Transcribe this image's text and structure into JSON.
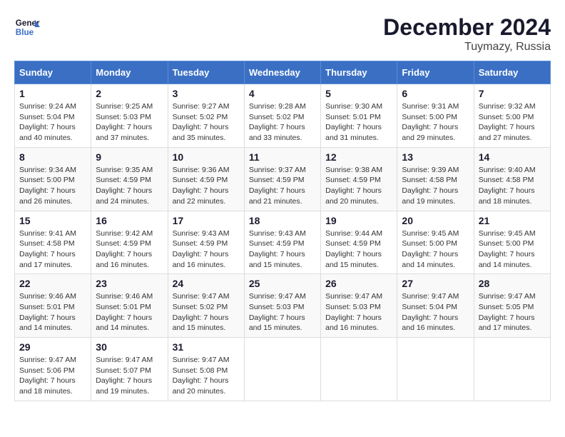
{
  "logo": {
    "line1": "General",
    "line2": "Blue"
  },
  "header": {
    "month": "December 2024",
    "location": "Tuymazy, Russia"
  },
  "weekdays": [
    "Sunday",
    "Monday",
    "Tuesday",
    "Wednesday",
    "Thursday",
    "Friday",
    "Saturday"
  ],
  "weeks": [
    [
      {
        "day": "1",
        "content": "Sunrise: 9:24 AM\nSunset: 5:04 PM\nDaylight: 7 hours\nand 40 minutes."
      },
      {
        "day": "2",
        "content": "Sunrise: 9:25 AM\nSunset: 5:03 PM\nDaylight: 7 hours\nand 37 minutes."
      },
      {
        "day": "3",
        "content": "Sunrise: 9:27 AM\nSunset: 5:02 PM\nDaylight: 7 hours\nand 35 minutes."
      },
      {
        "day": "4",
        "content": "Sunrise: 9:28 AM\nSunset: 5:02 PM\nDaylight: 7 hours\nand 33 minutes."
      },
      {
        "day": "5",
        "content": "Sunrise: 9:30 AM\nSunset: 5:01 PM\nDaylight: 7 hours\nand 31 minutes."
      },
      {
        "day": "6",
        "content": "Sunrise: 9:31 AM\nSunset: 5:00 PM\nDaylight: 7 hours\nand 29 minutes."
      },
      {
        "day": "7",
        "content": "Sunrise: 9:32 AM\nSunset: 5:00 PM\nDaylight: 7 hours\nand 27 minutes."
      }
    ],
    [
      {
        "day": "8",
        "content": "Sunrise: 9:34 AM\nSunset: 5:00 PM\nDaylight: 7 hours\nand 26 minutes."
      },
      {
        "day": "9",
        "content": "Sunrise: 9:35 AM\nSunset: 4:59 PM\nDaylight: 7 hours\nand 24 minutes."
      },
      {
        "day": "10",
        "content": "Sunrise: 9:36 AM\nSunset: 4:59 PM\nDaylight: 7 hours\nand 22 minutes."
      },
      {
        "day": "11",
        "content": "Sunrise: 9:37 AM\nSunset: 4:59 PM\nDaylight: 7 hours\nand 21 minutes."
      },
      {
        "day": "12",
        "content": "Sunrise: 9:38 AM\nSunset: 4:59 PM\nDaylight: 7 hours\nand 20 minutes."
      },
      {
        "day": "13",
        "content": "Sunrise: 9:39 AM\nSunset: 4:58 PM\nDaylight: 7 hours\nand 19 minutes."
      },
      {
        "day": "14",
        "content": "Sunrise: 9:40 AM\nSunset: 4:58 PM\nDaylight: 7 hours\nand 18 minutes."
      }
    ],
    [
      {
        "day": "15",
        "content": "Sunrise: 9:41 AM\nSunset: 4:58 PM\nDaylight: 7 hours\nand 17 minutes."
      },
      {
        "day": "16",
        "content": "Sunrise: 9:42 AM\nSunset: 4:59 PM\nDaylight: 7 hours\nand 16 minutes."
      },
      {
        "day": "17",
        "content": "Sunrise: 9:43 AM\nSunset: 4:59 PM\nDaylight: 7 hours\nand 16 minutes."
      },
      {
        "day": "18",
        "content": "Sunrise: 9:43 AM\nSunset: 4:59 PM\nDaylight: 7 hours\nand 15 minutes."
      },
      {
        "day": "19",
        "content": "Sunrise: 9:44 AM\nSunset: 4:59 PM\nDaylight: 7 hours\nand 15 minutes."
      },
      {
        "day": "20",
        "content": "Sunrise: 9:45 AM\nSunset: 5:00 PM\nDaylight: 7 hours\nand 14 minutes."
      },
      {
        "day": "21",
        "content": "Sunrise: 9:45 AM\nSunset: 5:00 PM\nDaylight: 7 hours\nand 14 minutes."
      }
    ],
    [
      {
        "day": "22",
        "content": "Sunrise: 9:46 AM\nSunset: 5:01 PM\nDaylight: 7 hours\nand 14 minutes."
      },
      {
        "day": "23",
        "content": "Sunrise: 9:46 AM\nSunset: 5:01 PM\nDaylight: 7 hours\nand 14 minutes."
      },
      {
        "day": "24",
        "content": "Sunrise: 9:47 AM\nSunset: 5:02 PM\nDaylight: 7 hours\nand 15 minutes."
      },
      {
        "day": "25",
        "content": "Sunrise: 9:47 AM\nSunset: 5:03 PM\nDaylight: 7 hours\nand 15 minutes."
      },
      {
        "day": "26",
        "content": "Sunrise: 9:47 AM\nSunset: 5:03 PM\nDaylight: 7 hours\nand 16 minutes."
      },
      {
        "day": "27",
        "content": "Sunrise: 9:47 AM\nSunset: 5:04 PM\nDaylight: 7 hours\nand 16 minutes."
      },
      {
        "day": "28",
        "content": "Sunrise: 9:47 AM\nSunset: 5:05 PM\nDaylight: 7 hours\nand 17 minutes."
      }
    ],
    [
      {
        "day": "29",
        "content": "Sunrise: 9:47 AM\nSunset: 5:06 PM\nDaylight: 7 hours\nand 18 minutes."
      },
      {
        "day": "30",
        "content": "Sunrise: 9:47 AM\nSunset: 5:07 PM\nDaylight: 7 hours\nand 19 minutes."
      },
      {
        "day": "31",
        "content": "Sunrise: 9:47 AM\nSunset: 5:08 PM\nDaylight: 7 hours\nand 20 minutes."
      },
      {
        "day": "",
        "content": ""
      },
      {
        "day": "",
        "content": ""
      },
      {
        "day": "",
        "content": ""
      },
      {
        "day": "",
        "content": ""
      }
    ]
  ]
}
